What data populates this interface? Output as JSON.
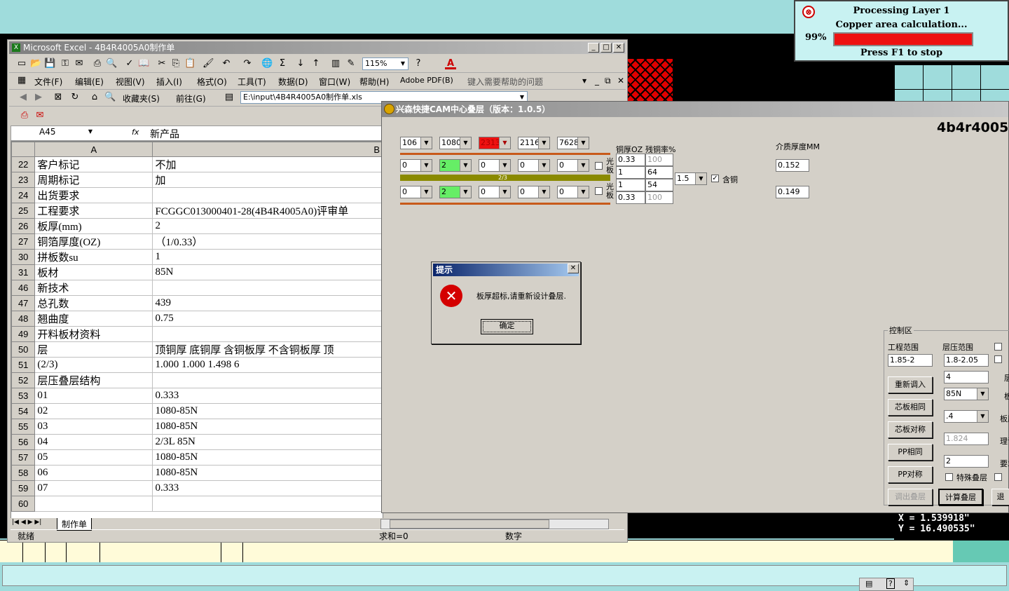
{
  "progress": {
    "line1": "Processing Layer 1",
    "line2": "Copper area calculation...",
    "percent": "99%",
    "stop": "Press F1 to stop",
    "fill_fraction": 1.0
  },
  "coords": {
    "x": "X = 1.539918\"",
    "y": "Y = 16.490535\""
  },
  "excel": {
    "title": "Microsoft Excel - 4B4R4005A0制作单",
    "menu": [
      "文件(F)",
      "编辑(E)",
      "视图(V)",
      "插入(I)",
      "格式(O)",
      "工具(T)",
      "数据(D)",
      "窗口(W)",
      "帮助(H)",
      "Adobe PDF(B)"
    ],
    "help_placeholder": "键入需要帮助的问题",
    "zoom": "115%",
    "web": {
      "favorites": "收藏夹(S)",
      "goto": "前往(G)",
      "address": "E:\\input\\4B4R4005A0制作单.xls"
    },
    "name_box": "A45",
    "fx": "fx",
    "formula": "新产品",
    "col_a": "A",
    "col_b": "B",
    "rows": [
      {
        "n": "22",
        "a": "客户标记",
        "b": "不加"
      },
      {
        "n": "23",
        "a": "周期标记",
        "b": "加"
      },
      {
        "n": "24",
        "a": "出货要求",
        "b": ""
      },
      {
        "n": "25",
        "a": "工程要求",
        "b": "FCGGC013000401-28(4B4R4005A0)评审单"
      },
      {
        "n": "26",
        "a": "板厚(mm)",
        "b": "2"
      },
      {
        "n": "27",
        "a": "铜箔厚度(OZ)",
        "b": "（1/0.33）"
      },
      {
        "n": "30",
        "a": "拼板数su",
        "b": "1"
      },
      {
        "n": "31",
        "a": "板材",
        "b": "85N"
      },
      {
        "n": "46",
        "a": "新技术",
        "b": ""
      },
      {
        "n": "47",
        "a": "总孔数",
        "b": "439"
      },
      {
        "n": "48",
        "a": "翘曲度",
        "b": "0.75"
      },
      {
        "n": "49",
        "a": "开料板材资料",
        "b": ""
      },
      {
        "n": "50",
        "a": "层",
        "b": "顶铜厚  底铜厚  含铜板厚  不含铜板厚  顶"
      },
      {
        "n": "51",
        "a": "(2/3)",
        "b": "1.000   1.000          1.498        6"
      },
      {
        "n": "52",
        "a": "层压叠层结构",
        "b": ""
      },
      {
        "n": "53",
        "a": "01",
        "b": "0.333"
      },
      {
        "n": "54",
        "a": "02",
        "b": "1080-85N"
      },
      {
        "n": "55",
        "a": "03",
        "b": "1080-85N"
      },
      {
        "n": "56",
        "a": "04",
        "b": "2/3L 85N"
      },
      {
        "n": "57",
        "a": "05",
        "b": "1080-85N"
      },
      {
        "n": "58",
        "a": "06",
        "b": "1080-85N"
      },
      {
        "n": "59",
        "a": "07",
        "b": "0.333"
      },
      {
        "n": "60",
        "a": "",
        "b": ""
      }
    ],
    "sheet_tab": "制作单",
    "status": {
      "ready": "就绪",
      "sum": "求和=0",
      "mode": "数字"
    }
  },
  "cam": {
    "title": "兴森快捷CAM中心叠层（版本：1.0.5）",
    "part": "4b4r4005",
    "top_selects": [
      "106",
      "1080",
      "2313",
      "2116",
      "7628"
    ],
    "row1_selects": [
      "0",
      "2",
      "0",
      "0",
      "0"
    ],
    "mid_label": "2/3",
    "row2_selects": [
      "0",
      "2",
      "0",
      "0",
      "0"
    ],
    "guang_ban": "光板",
    "hdr_cu": "铜厚OZ",
    "hdr_res": "残铜率%",
    "cu_vals": [
      "0.33",
      "1",
      "1",
      "0.33"
    ],
    "res_vals": [
      "100",
      "64",
      "54",
      "100"
    ],
    "ratio_select": "1.5",
    "han_tong": "含铜",
    "dielectric_hdr": "介质厚度MM",
    "dielectric_vals": [
      "0.152",
      "0.149"
    ],
    "control": {
      "title": "控制区",
      "eng_range_lbl": "工程范围",
      "eng_range": "1.85-2",
      "press_range_lbl": "层压范围",
      "press_range": "1.8-2.05",
      "layers": "4",
      "material": "85N",
      "thick": ".4",
      "theory": "1.824",
      "req": "2",
      "special": "特殊叠层",
      "buttons": [
        "重新调入",
        "芯板相同",
        "芯板对称",
        "PP相同",
        "PP对称"
      ],
      "btn_export": "调出叠层",
      "btn_calc": "计算叠层",
      "btn_exit": "退",
      "side_labels": [
        "层",
        "板",
        "板厚",
        "理论",
        "要求"
      ]
    }
  },
  "dialog": {
    "title": "提示",
    "message": "板厚超标,请重新设计叠层.",
    "ok": "确定"
  },
  "colors": {
    "excel_bg": "#d4d0c8",
    "dialog_title": "#0a246a",
    "progress_bar": "#ee1111",
    "cam_bg": "#000000",
    "highlight_red": "#ee1111",
    "highlight_green": "#66ee66"
  }
}
